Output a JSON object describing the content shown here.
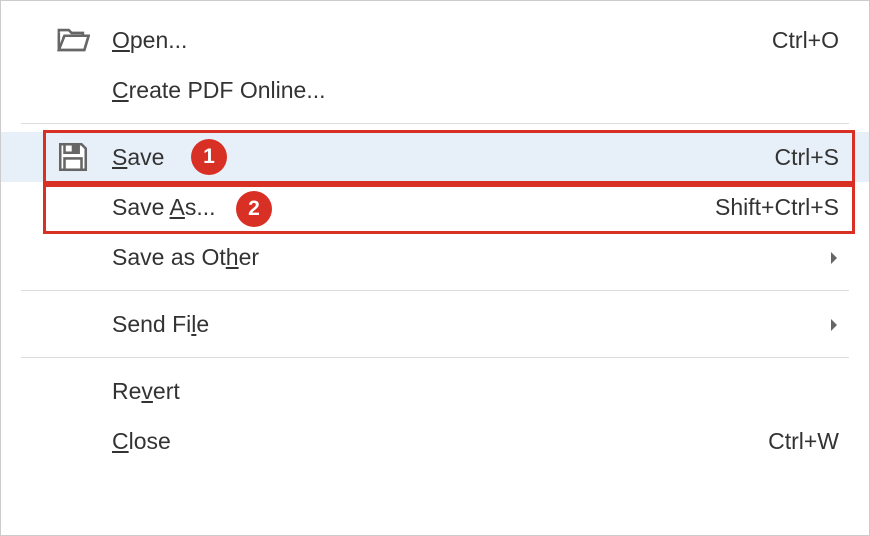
{
  "menu": {
    "items": [
      {
        "label_pre": "",
        "label_u": "O",
        "label_post": "pen...",
        "shortcut": "Ctrl+O",
        "icon": "folder-open-icon",
        "has_submenu": false
      },
      {
        "label_pre": "",
        "label_u": "C",
        "label_post": "reate PDF Online...",
        "shortcut": "",
        "icon": "",
        "has_submenu": false
      },
      {
        "label_pre": "",
        "label_u": "S",
        "label_post": "ave",
        "shortcut": "Ctrl+S",
        "icon": "save-icon",
        "has_submenu": false,
        "highlighted": true,
        "callout": "1"
      },
      {
        "label_pre": "Save ",
        "label_u": "A",
        "label_post": "s...",
        "shortcut": "Shift+Ctrl+S",
        "icon": "",
        "has_submenu": false,
        "callout": "2"
      },
      {
        "label_pre": "Save as Ot",
        "label_u": "h",
        "label_post": "er",
        "shortcut": "",
        "icon": "",
        "has_submenu": true
      },
      {
        "label_pre": "Send Fi",
        "label_u": "l",
        "label_post": "e",
        "shortcut": "",
        "icon": "",
        "has_submenu": true
      },
      {
        "label_pre": "Re",
        "label_u": "v",
        "label_post": "ert",
        "shortcut": "",
        "icon": "",
        "has_submenu": false
      },
      {
        "label_pre": "",
        "label_u": "C",
        "label_post": "lose",
        "shortcut": "Ctrl+W",
        "icon": "",
        "has_submenu": false
      }
    ],
    "callouts": {
      "1": "1",
      "2": "2"
    }
  }
}
